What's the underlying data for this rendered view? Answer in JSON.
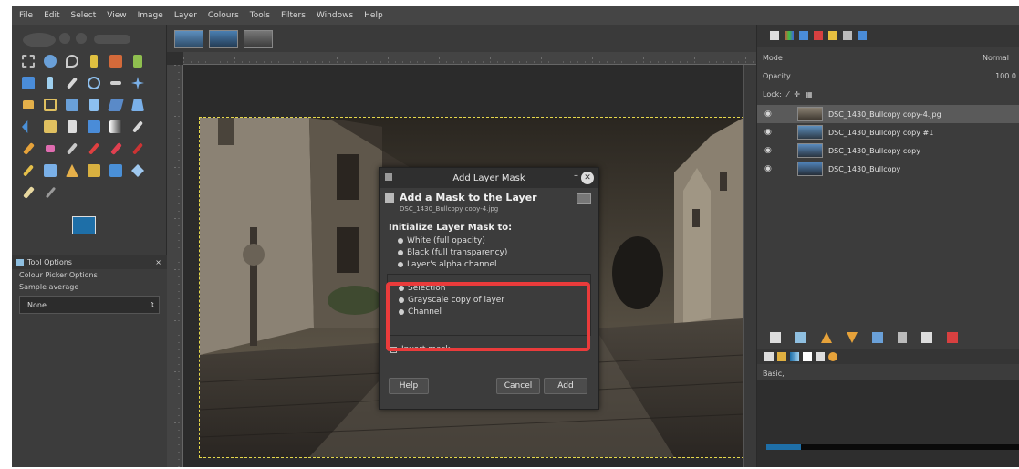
{
  "menu": [
    "File",
    "Edit",
    "Select",
    "View",
    "Image",
    "Layer",
    "Colours",
    "Tools",
    "Filters",
    "Windows",
    "Help"
  ],
  "tool_options": {
    "tab_label": "Tool Options",
    "line1": "Colour Picker Options",
    "line2": "Sample average",
    "combo_value": "None"
  },
  "dialog": {
    "title": "Add Layer Mask",
    "heading": "Add a Mask to the Layer",
    "subtitle": "DSC_1430_Bullcopy copy-4.jpg",
    "section": "Initialize Layer Mask to:",
    "options_top": [
      "White (full opacity)",
      "Black (full transparency)",
      "Layer's alpha channel"
    ],
    "options_list": [
      "Selection",
      "Grayscale copy of layer",
      "Channel"
    ],
    "invert_label": "Invert mask",
    "help": "Help",
    "cancel": "Cancel",
    "add": "Add"
  },
  "dock": {
    "mode_label": "Mode",
    "mode_value": "Normal",
    "opacity_label": "Opacity",
    "opacity_value": "100.0",
    "lock_label": "Lock:",
    "brushes_label": "Basic,"
  },
  "layers": [
    {
      "name": "DSC_1430_Bullcopy copy-4.jpg",
      "selected": true
    },
    {
      "name": "DSC_1430_Bullcopy copy #1",
      "selected": false
    },
    {
      "name": "DSC_1430_Bullcopy copy",
      "selected": false
    },
    {
      "name": "DSC_1430_Bullcopy",
      "selected": false
    }
  ],
  "colors": {
    "accent": "#1e6fa8",
    "highlight": "#ea3b3b",
    "selection": "#e6d84a"
  }
}
